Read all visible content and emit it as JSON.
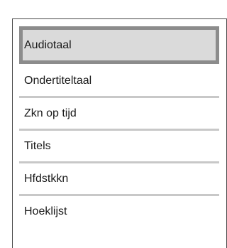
{
  "menu": {
    "items": [
      {
        "label": "Audiotaal",
        "selected": true
      },
      {
        "label": "Ondertiteltaal",
        "selected": false
      },
      {
        "label": "Zkn op tijd",
        "selected": false
      },
      {
        "label": "Titels",
        "selected": false
      },
      {
        "label": "Hfdstkkn",
        "selected": false
      },
      {
        "label": "Hoeklijst",
        "selected": false
      }
    ]
  },
  "colors": {
    "panel_border": "#4a4a4a",
    "selected_background": "#dadada",
    "selected_border": "#8c8c8c",
    "divider": "#c8c8c8",
    "text": "#1a1a1a"
  }
}
